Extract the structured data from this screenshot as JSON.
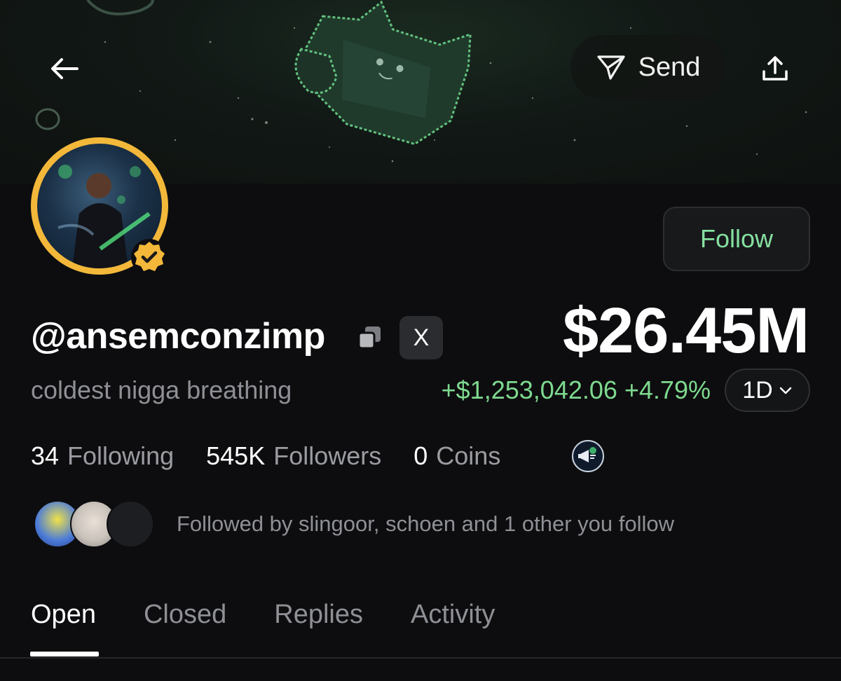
{
  "header": {
    "send_label": "Send",
    "icons": [
      "back-arrow-icon",
      "send-icon",
      "share-icon"
    ]
  },
  "profile": {
    "handle": "@ansemconzimp",
    "bio": "coldest nigga breathing",
    "follow_label": "Follow",
    "x_label": "X",
    "verified": true
  },
  "portfolio": {
    "balance": "$26.45M",
    "change": "+$1,253,042.06 +4.79%",
    "range": "1D"
  },
  "stats": [
    {
      "value": "34",
      "label": "Following"
    },
    {
      "value": "545K",
      "label": "Followers"
    },
    {
      "value": "0",
      "label": "Coins"
    }
  ],
  "followed_by": "Followed by slingoor, schoen and 1 other you follow",
  "tabs": [
    {
      "label": "Open",
      "active": true
    },
    {
      "label": "Closed",
      "active": false
    },
    {
      "label": "Replies",
      "active": false
    },
    {
      "label": "Activity",
      "active": false
    }
  ],
  "colors": {
    "accent_green": "#7ed98f",
    "avatar_ring": "#f3b83a",
    "background": "#0d0d0f"
  }
}
